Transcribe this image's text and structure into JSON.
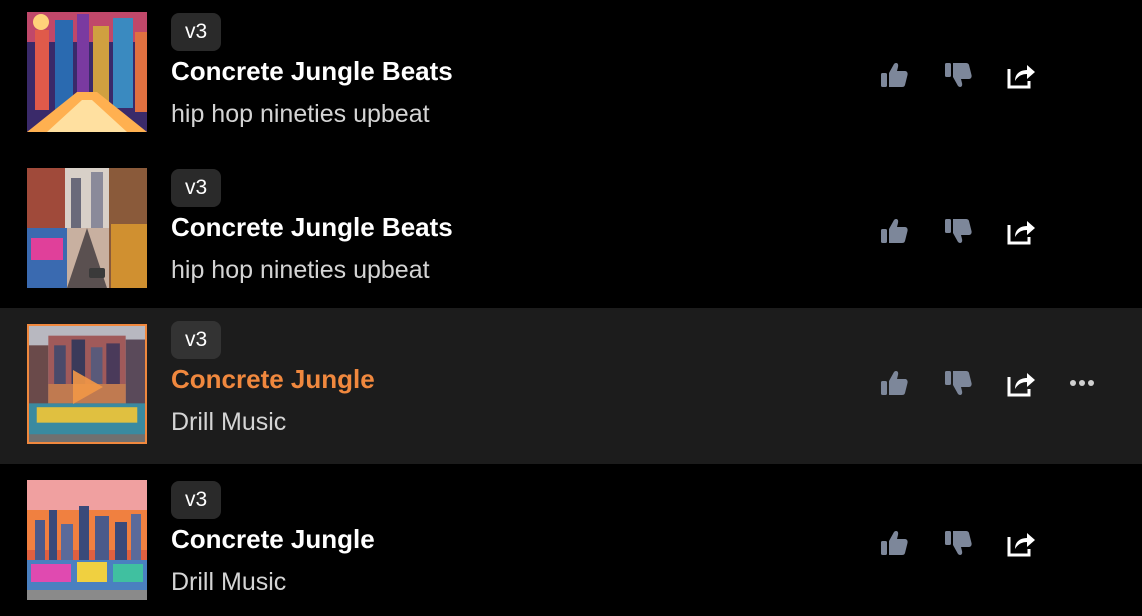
{
  "tracks": [
    {
      "version": "v3",
      "title": "Concrete Jungle Beats",
      "description": "hip hop nineties upbeat",
      "active": false,
      "thumb_icon": "cityscape-artwork"
    },
    {
      "version": "v3",
      "title": "Concrete Jungle Beats",
      "description": "hip hop nineties upbeat",
      "active": false,
      "thumb_icon": "graffiti-street-artwork"
    },
    {
      "version": "v3",
      "title": "Concrete Jungle",
      "description": "Drill Music",
      "active": true,
      "thumb_icon": "graffiti-wall-artwork"
    },
    {
      "version": "v3",
      "title": "Concrete Jungle",
      "description": "Drill Music",
      "active": false,
      "thumb_icon": "graffiti-skyline-artwork"
    }
  ],
  "actions": {
    "like_icon": "thumbs-up-icon",
    "dislike_icon": "thumbs-down-icon",
    "share_icon": "share-icon",
    "more_icon": "more-options-icon"
  },
  "colors": {
    "background": "#000000",
    "active_row": "#1c1c1c",
    "accent": "#f0883e",
    "badge": "#2a2a2a",
    "icon": "#8892a6"
  }
}
